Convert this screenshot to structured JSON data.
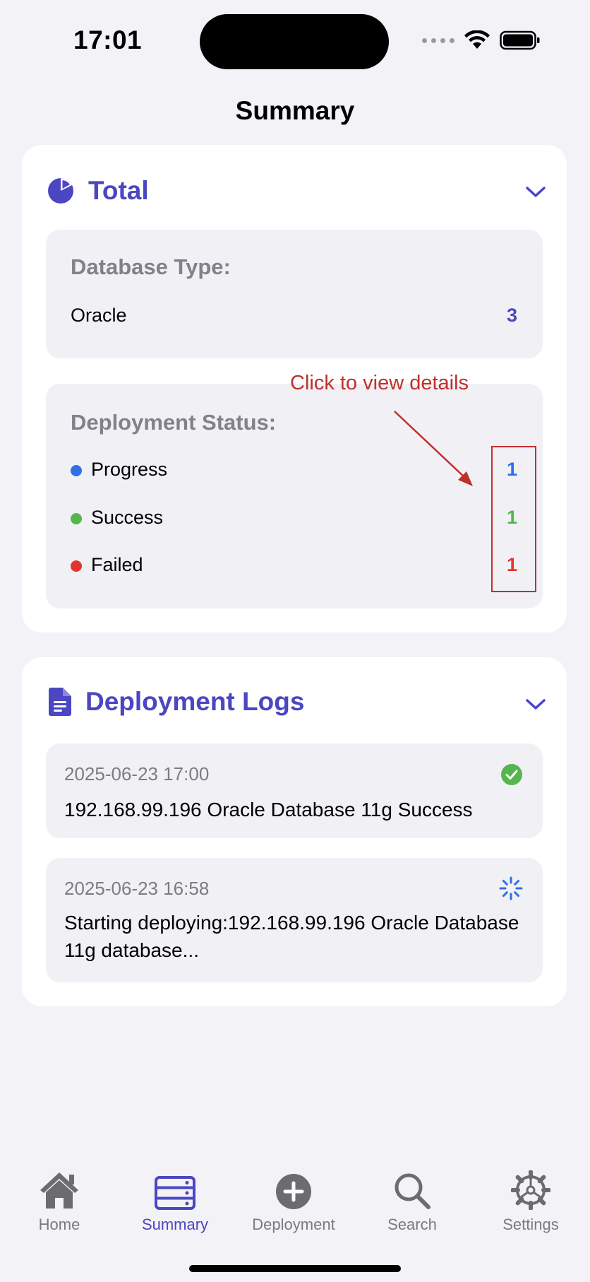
{
  "status_bar": {
    "time": "17:01"
  },
  "page_title": "Summary",
  "total_card": {
    "title": "Total",
    "database_type": {
      "label": "Database Type:",
      "rows": [
        {
          "name": "Oracle",
          "count": "3"
        }
      ]
    },
    "deployment_status": {
      "label": "Deployment Status:",
      "rows": [
        {
          "name": "Progress",
          "count": "1",
          "color": "#2f6fea"
        },
        {
          "name": "Success",
          "count": "1",
          "color": "#55b64e"
        },
        {
          "name": "Failed",
          "count": "1",
          "color": "#e5342c"
        }
      ]
    },
    "annotation": "Click to view details"
  },
  "logs_card": {
    "title": "Deployment Logs",
    "entries": [
      {
        "time": "2025-06-23 17:00",
        "message": "192.168.99.196 Oracle Database 11g Success",
        "status_icon": "success-check-icon"
      },
      {
        "time": "2025-06-23 16:58",
        "message": "Starting deploying:192.168.99.196 Oracle Database 11g database...",
        "status_icon": "loading-spinner-icon"
      }
    ]
  },
  "tab_bar": {
    "items": [
      {
        "label": "Home",
        "icon": "home-icon"
      },
      {
        "label": "Summary",
        "icon": "summary-icon",
        "active": true
      },
      {
        "label": "Deployment",
        "icon": "add-circle-icon"
      },
      {
        "label": "Search",
        "icon": "search-icon"
      },
      {
        "label": "Settings",
        "icon": "gear-icon"
      }
    ]
  },
  "colors": {
    "accent": "#4b46c2",
    "progress": "#2f6fea",
    "success": "#55b64e",
    "failed": "#e5342c",
    "annotation": "#c0302b"
  }
}
